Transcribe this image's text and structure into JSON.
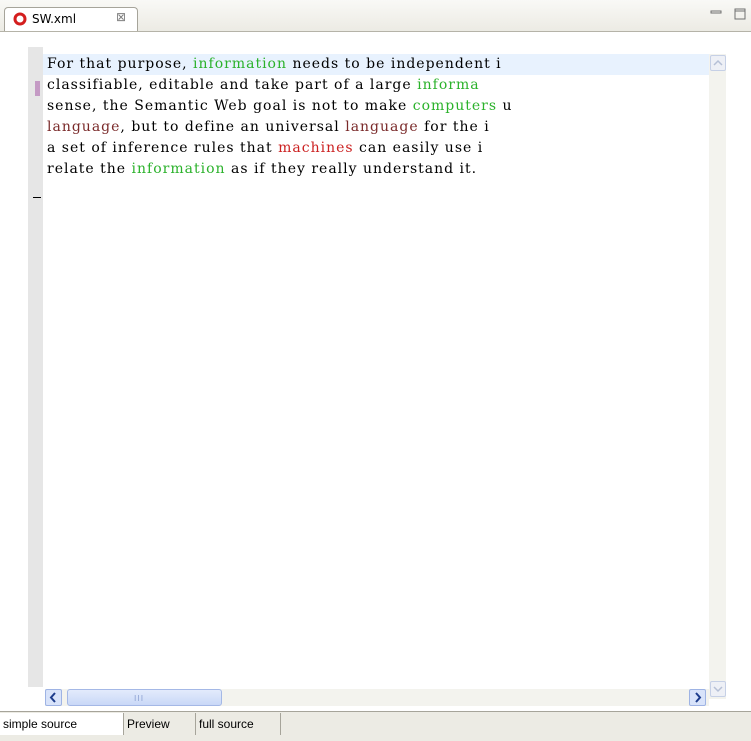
{
  "editor_tab": {
    "title": "SW.xml",
    "close_glyph": "⊠",
    "icon": "xml-file-icon"
  },
  "window_controls": {
    "minimize_icon": "minimize-icon",
    "maximize_icon": "maximize-icon"
  },
  "editor": {
    "lines": [
      [
        {
          "text": "For that purpose, ",
          "style": "plain"
        },
        {
          "text": "information",
          "style": "green"
        },
        {
          "text": " needs to be independent i",
          "style": "plain"
        }
      ],
      [
        {
          "text": "classifiable, editable and take part of a large ",
          "style": "plain"
        },
        {
          "text": "informa",
          "style": "green"
        }
      ],
      [
        {
          "text": "sense, the Semantic Web goal is not to make ",
          "style": "plain"
        },
        {
          "text": "computers",
          "style": "green"
        },
        {
          "text": " u",
          "style": "plain"
        }
      ],
      [
        {
          "text": "language",
          "style": "dark"
        },
        {
          "text": ", but to define an universal ",
          "style": "plain"
        },
        {
          "text": "language",
          "style": "dark"
        },
        {
          "text": " for the i",
          "style": "plain"
        }
      ],
      [
        {
          "text": "a set of inference rules that ",
          "style": "plain"
        },
        {
          "text": "machines",
          "style": "red"
        },
        {
          "text": " can easily use i",
          "style": "plain"
        }
      ],
      [
        {
          "text": "relate the ",
          "style": "plain"
        },
        {
          "text": "information",
          "style": "green"
        },
        {
          "text": " as if they really understand it.",
          "style": "plain"
        }
      ]
    ]
  },
  "scrollbars": {
    "horizontal_grip": "III",
    "horizontal_position": 0.0
  },
  "bottom_tabs": [
    {
      "label": "simple source",
      "active": true
    },
    {
      "label": "Preview",
      "active": false
    },
    {
      "label": "full source",
      "active": false
    }
  ]
}
